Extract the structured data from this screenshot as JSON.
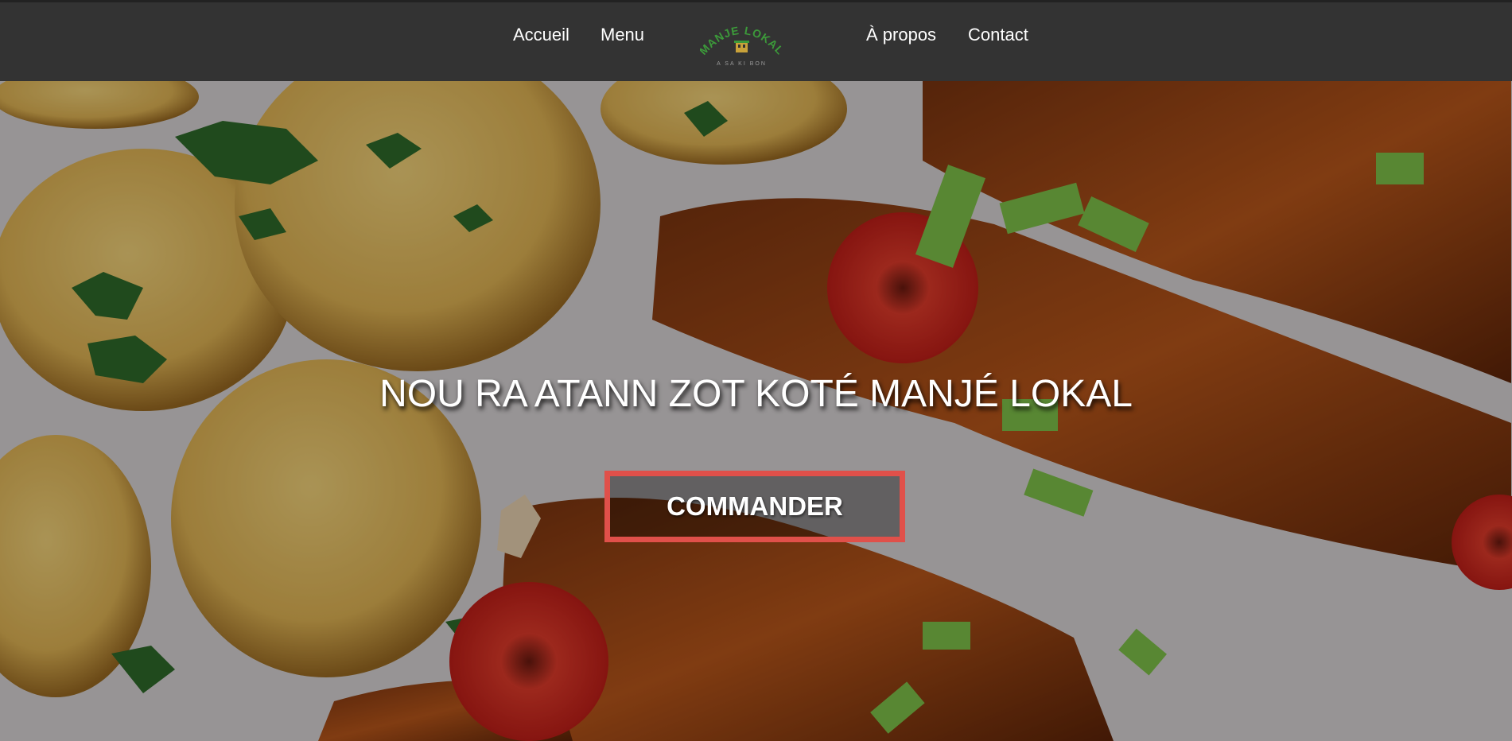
{
  "nav": {
    "links": [
      {
        "label": "Accueil"
      },
      {
        "label": "Menu"
      },
      {
        "label": "À propos"
      },
      {
        "label": "Contact"
      }
    ],
    "logo": {
      "name": "MANJE LOKAL",
      "tagline": "A SA KI BON"
    }
  },
  "hero": {
    "title": "NOU RA ATANN ZOT KOTÉ MANJÉ LOKAL",
    "cta_label": "COMMANDER"
  },
  "colors": {
    "navbar": "#333333",
    "cta_border": "#e0504a",
    "logo_green": "#3c9a3a"
  }
}
